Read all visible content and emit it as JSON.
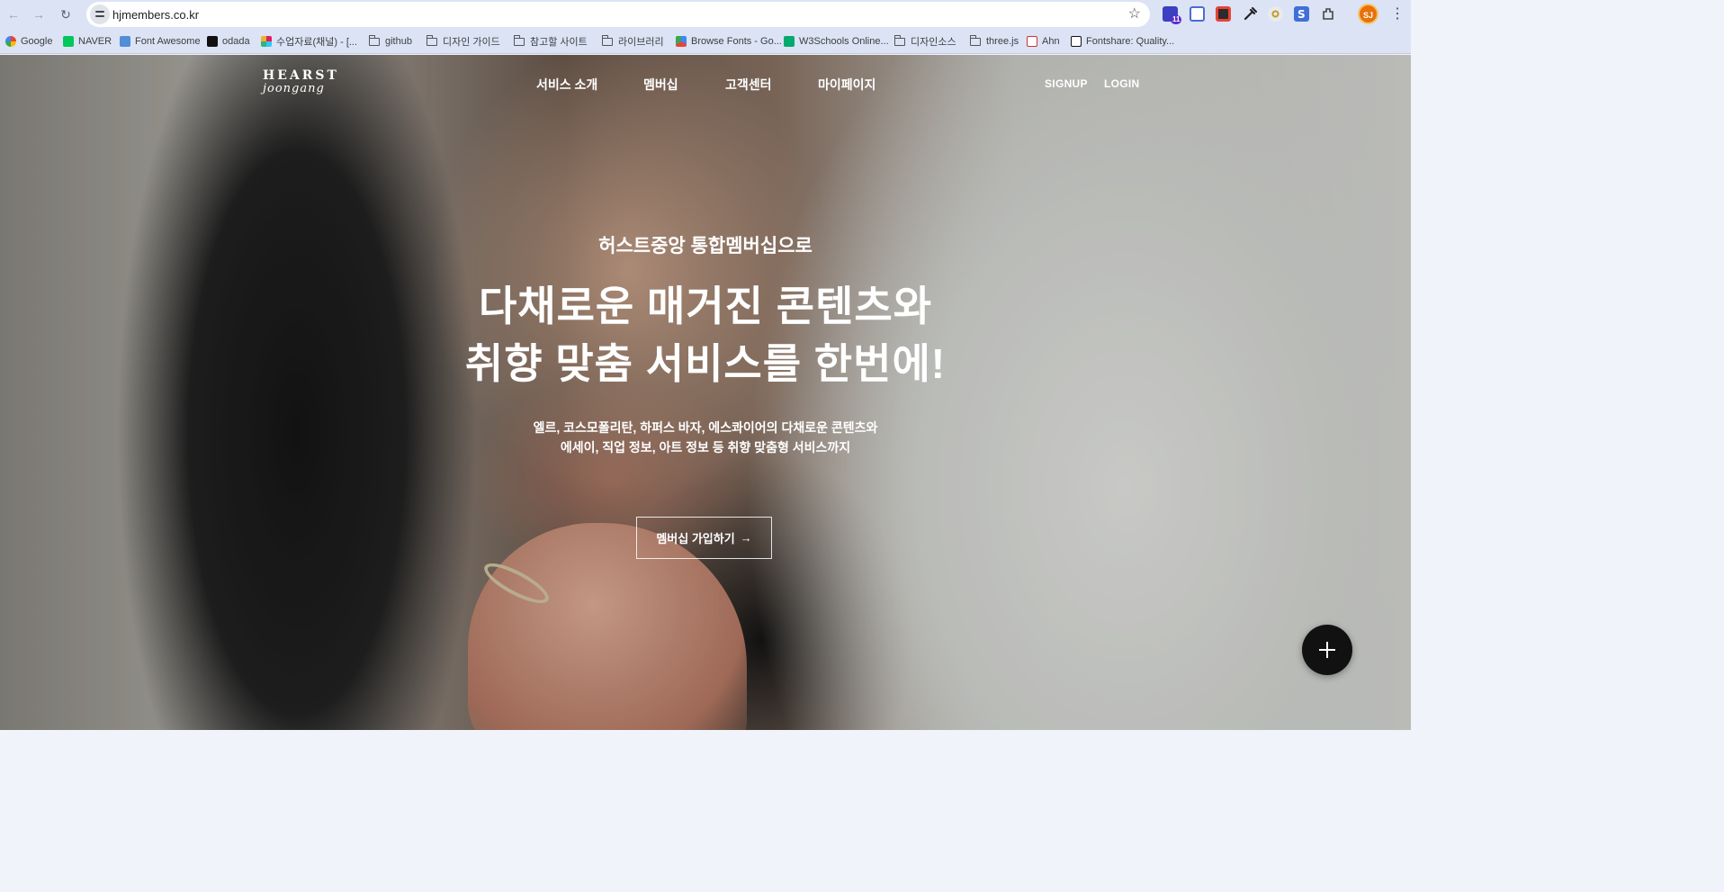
{
  "browser": {
    "url": "hjmembers.co.kr",
    "extension_badge": "11",
    "profile_initials": "SJ",
    "bookmarks": [
      {
        "label": "Google"
      },
      {
        "label": "NAVER"
      },
      {
        "label": "Font Awesome"
      },
      {
        "label": "odada"
      },
      {
        "label": "수업자료(채널) - [..."
      },
      {
        "label": "github"
      },
      {
        "label": "디자인 가이드"
      },
      {
        "label": "참고할 사이트"
      },
      {
        "label": "라이브러리"
      },
      {
        "label": "Browse Fonts - Go..."
      },
      {
        "label": "W3Schools Online..."
      },
      {
        "label": "디자인소스"
      },
      {
        "label": "three.js"
      },
      {
        "label": "Ahn"
      },
      {
        "label": "Fontshare: Quality..."
      }
    ]
  },
  "site": {
    "logo_top": "HEARST",
    "logo_bottom": "joongang",
    "nav": [
      "서비스 소개",
      "멤버십",
      "고객센터",
      "마이페이지"
    ],
    "signup": "SIGNUP",
    "login": "LOGIN"
  },
  "hero": {
    "eyebrow": "허스트중앙 통합멤버십으로",
    "headline_line1": "다채로운 매거진 콘텐츠와",
    "headline_line2": "취향 맞춤 서비스를 한번에!",
    "desc_line1": "엘르, 코스모폴리탄, 하퍼스 바자, 에스콰이어의 다채로운 콘텐츠와",
    "desc_line2": "에세이, 직업 정보, 아트 정보 등 취향 맞춤형 서비스까지",
    "cta": "멤버십 가입하기",
    "cta_arrow": "→"
  },
  "colors": {
    "chrome_bg": "#dbe3f5",
    "text_white": "#ffffff",
    "fab_bg": "#111111"
  }
}
